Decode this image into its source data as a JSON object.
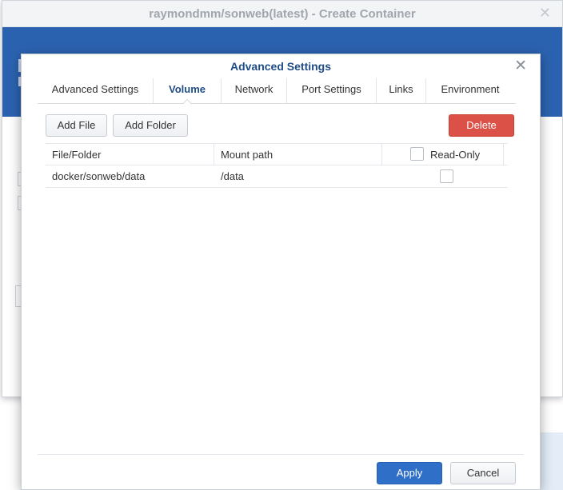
{
  "outer_window": {
    "title": "raymondmm/sonweb(latest) - Create Container",
    "close_icon": "close-icon"
  },
  "modal": {
    "title": "Advanced Settings",
    "close_icon": "close-icon",
    "tabs": [
      {
        "label": "Advanced Settings",
        "active": false
      },
      {
        "label": "Volume",
        "active": true
      },
      {
        "label": "Network",
        "active": false
      },
      {
        "label": "Port Settings",
        "active": false
      },
      {
        "label": "Links",
        "active": false
      },
      {
        "label": "Environment",
        "active": false
      }
    ],
    "toolbar": {
      "add_file_label": "Add File",
      "add_folder_label": "Add Folder",
      "delete_label": "Delete"
    },
    "table": {
      "columns": [
        "File/Folder",
        "Mount path",
        "Read-Only"
      ],
      "rows": [
        {
          "file_folder": "docker/sonweb/data",
          "mount_path": "/data",
          "read_only": false
        }
      ]
    },
    "footer": {
      "apply_label": "Apply",
      "cancel_label": "Cancel"
    }
  },
  "colors": {
    "accent": "#1f4d86",
    "banner": "#2b62b0",
    "delete": "#dc5147",
    "apply": "#2f6fc8"
  }
}
